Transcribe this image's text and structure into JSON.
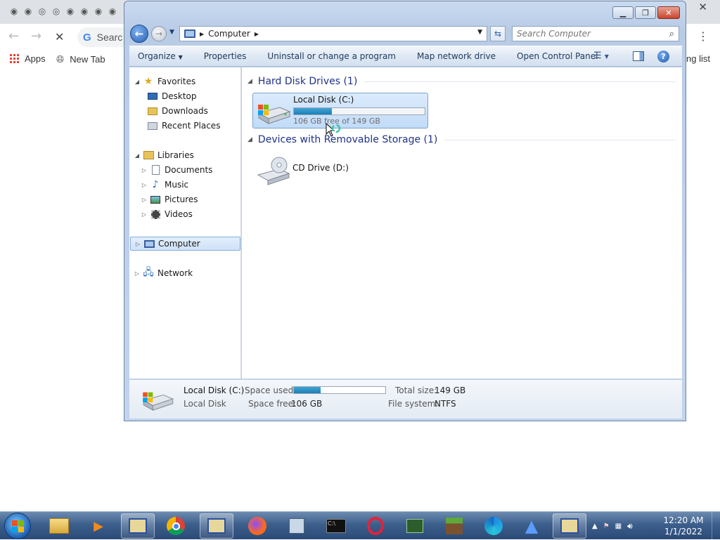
{
  "browser": {
    "omnibox_text": "Searc",
    "close_tab": "✕",
    "menu": "⋮",
    "bookmarks": [
      {
        "label": "Apps"
      },
      {
        "label": "New Tab"
      }
    ],
    "reading_list": "ng list"
  },
  "explorer": {
    "address": {
      "location": "Computer"
    },
    "search_placeholder": "Search Computer",
    "commands": {
      "organize": "Organize",
      "properties": "Properties",
      "uninstall": "Uninstall or change a program",
      "map_drive": "Map network drive",
      "control_panel": "Open Control Panel"
    },
    "nav": {
      "favorites": "Favorites",
      "desktop": "Desktop",
      "downloads": "Downloads",
      "recent": "Recent Places",
      "libraries": "Libraries",
      "documents": "Documents",
      "music": "Music",
      "pictures": "Pictures",
      "videos": "Videos",
      "computer": "Computer",
      "network": "Network"
    },
    "groups": {
      "hdd": "Hard Disk Drives (1)",
      "removable": "Devices with Removable Storage (1)"
    },
    "drives": {
      "c": {
        "name": "Local Disk (C:)",
        "free_text": "106 GB free of 149 GB",
        "used_fraction": 0.29
      },
      "d": {
        "name": "CD Drive (D:)"
      }
    },
    "details": {
      "name": "Local Disk (C:)",
      "type": "Local Disk",
      "space_used_label": "Space used:",
      "space_free_label": "Space free:",
      "space_free_value": "106 GB",
      "total_size_label": "Total size:",
      "total_size_value": "149 GB",
      "filesystem_label": "File system:",
      "filesystem_value": "NTFS",
      "used_fraction": 0.29
    }
  },
  "taskbar": {
    "clock_time": "12:20 AM",
    "clock_date": "1/1/2022"
  },
  "colors": {
    "accent": "#1e3287",
    "selection": "#cfe2f8",
    "capacity_bar": "#2a8fc4"
  }
}
